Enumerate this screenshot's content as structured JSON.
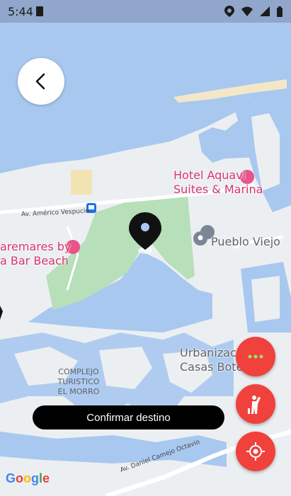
{
  "status_bar": {
    "time": "5:44"
  },
  "map": {
    "places": {
      "hotel_aquavi": [
        "Hotel Aquavi",
        "Suites & Marina"
      ],
      "pueblo_viejo": "Pueblo Viejo",
      "hotel_west": [
        "aremares by",
        "a Bar Beach"
      ],
      "urbanizacion": [
        "Urbanizació",
        "Casas Bote"
      ],
      "complejo": [
        "COMPLEJO",
        "TURISTICO",
        "EL MORRO"
      ]
    },
    "roads": {
      "vespucio": "Av. Américo Vespucio",
      "camejo": "Av. Daniel Camejo Octavio"
    },
    "attribution": "Google"
  },
  "actions": {
    "confirm_label": "Confirmar destino"
  },
  "icons": {
    "back": "chevron-left-icon",
    "more": "more-dots-icon",
    "hail": "person-hail-icon",
    "locate": "my-location-icon",
    "pin": "map-pin-icon"
  },
  "colors": {
    "accent": "#f1413c",
    "water": "#a8c8f0",
    "land": "#eceff1",
    "park": "#b7dfb9",
    "confirm_bg": "#000000"
  }
}
